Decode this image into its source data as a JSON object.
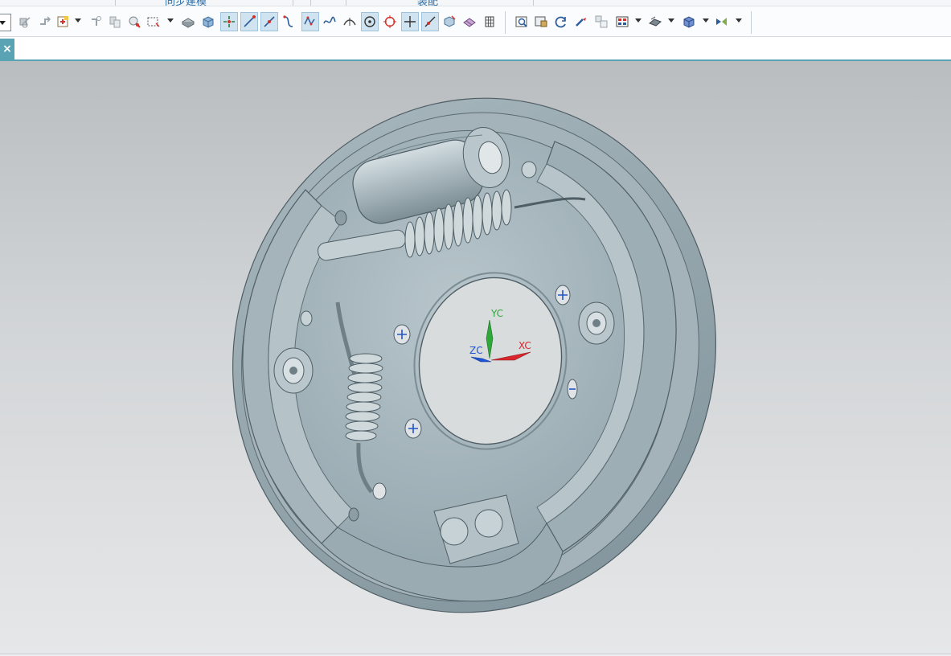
{
  "ribbon": {
    "partial_tabs": [
      "同步建模",
      "装配"
    ]
  },
  "toolbar": {
    "groups": [
      [
        "move-face-icon",
        "offset-face-icon",
        "point-snap-icon",
        "attach-icon",
        "copy-icon",
        "select-feature-icon",
        "rectangle-select-icon"
      ],
      [
        "solid-body-icon",
        "block-icon",
        "snap-point-icon",
        "line-icon",
        "line-tangent-icon",
        "arc-icon",
        "spline-icon",
        "curve-icon",
        "midpoint-icon",
        "center-point-icon",
        "quadrant-icon",
        "intersection-icon",
        "on-curve-icon",
        "face-icon",
        "polygon-icon",
        "grid-icon"
      ],
      [
        "fit-view-icon",
        "zoom-window-icon",
        "rotate-icon",
        "pan-icon",
        "perspective-icon",
        "render-style-icon",
        "wcs-icon",
        "orient-view-icon",
        "display-mode-icon"
      ]
    ],
    "active_icons": [
      "snap-point-icon",
      "line-icon",
      "line-tangent-icon",
      "curve-icon",
      "center-point-icon",
      "intersection-icon",
      "on-curve-icon"
    ]
  },
  "tab": {
    "close_label": "×"
  },
  "viewport": {
    "triad": {
      "x_label": "XC",
      "y_label": "YC",
      "z_label": "ZC"
    },
    "colors": {
      "x_axis": "#d8262c",
      "y_axis": "#2fa83a",
      "z_axis": "#1f55d4",
      "part": "#a9b9bf"
    }
  }
}
